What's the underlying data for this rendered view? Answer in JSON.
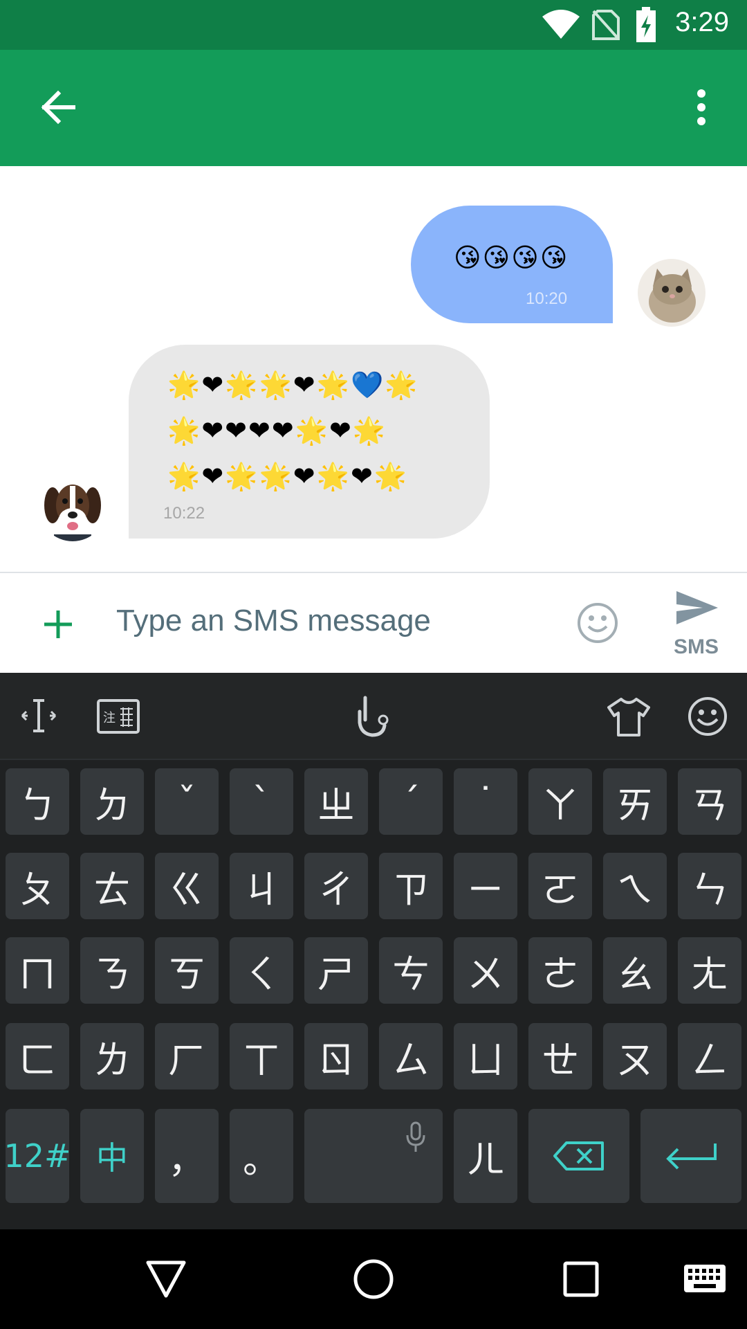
{
  "status_bar": {
    "time": "3:29"
  },
  "app_bar": {
    "back_icon": "arrow-left-icon",
    "menu_icon": "more-vert-icon"
  },
  "conversation": {
    "outgoing": {
      "emoji": "😘😘😘😘",
      "time": "10:20"
    },
    "incoming": {
      "rows": [
        "🌟❤🌟🌟❤🌟💙🌟",
        "🌟❤❤❤❤🌟❤🌟",
        "🌟❤🌟🌟❤🌟❤🌟"
      ],
      "time": "10:22"
    }
  },
  "compose": {
    "add_icon": "plus-icon",
    "placeholder": "Type an SMS message",
    "emoji_icon": "smiley-icon",
    "send_label": "SMS"
  },
  "keyboard": {
    "toolbar_icons": [
      "cursor-move-icon",
      "zhuyin-layout-icon",
      "gesture-touch-icon",
      "shirt-theme-icon",
      "emoji-face-icon"
    ],
    "rows": [
      [
        "ㄅ",
        "ㄉ",
        "ˇ",
        "ˋ",
        "ㄓ",
        "ˊ",
        "˙",
        "ㄚ",
        "ㄞ",
        "ㄢ"
      ],
      [
        "ㄆ",
        "ㄊ",
        "ㄍ",
        "ㄐ",
        "ㄔ",
        "ㄗ",
        "ㄧ",
        "ㄛ",
        "ㄟ",
        "ㄣ"
      ],
      [
        "ㄇ",
        "ㄋ",
        "ㄎ",
        "ㄑ",
        "ㄕ",
        "ㄘ",
        "ㄨ",
        "ㄜ",
        "ㄠ",
        "ㄤ"
      ],
      [
        "ㄈ",
        "ㄌ",
        "ㄏ",
        "ㄒ",
        "ㄖ",
        "ㄙ",
        "ㄩ",
        "ㄝ",
        "ㄡ",
        "ㄥ"
      ]
    ],
    "bottom": {
      "numbers": "12#",
      "lang": "中",
      "comma": "，",
      "period": "。",
      "er": "ㄦ"
    }
  },
  "colors": {
    "status_bar": "#0f7f47",
    "app_bar": "#139c59",
    "outgoing_bubble": "#8ab4fb",
    "incoming_bubble": "#e8e8e8",
    "keyboard_bg": "#1f2122",
    "key_bg": "#35393c",
    "accent": "#3fd1c9"
  }
}
